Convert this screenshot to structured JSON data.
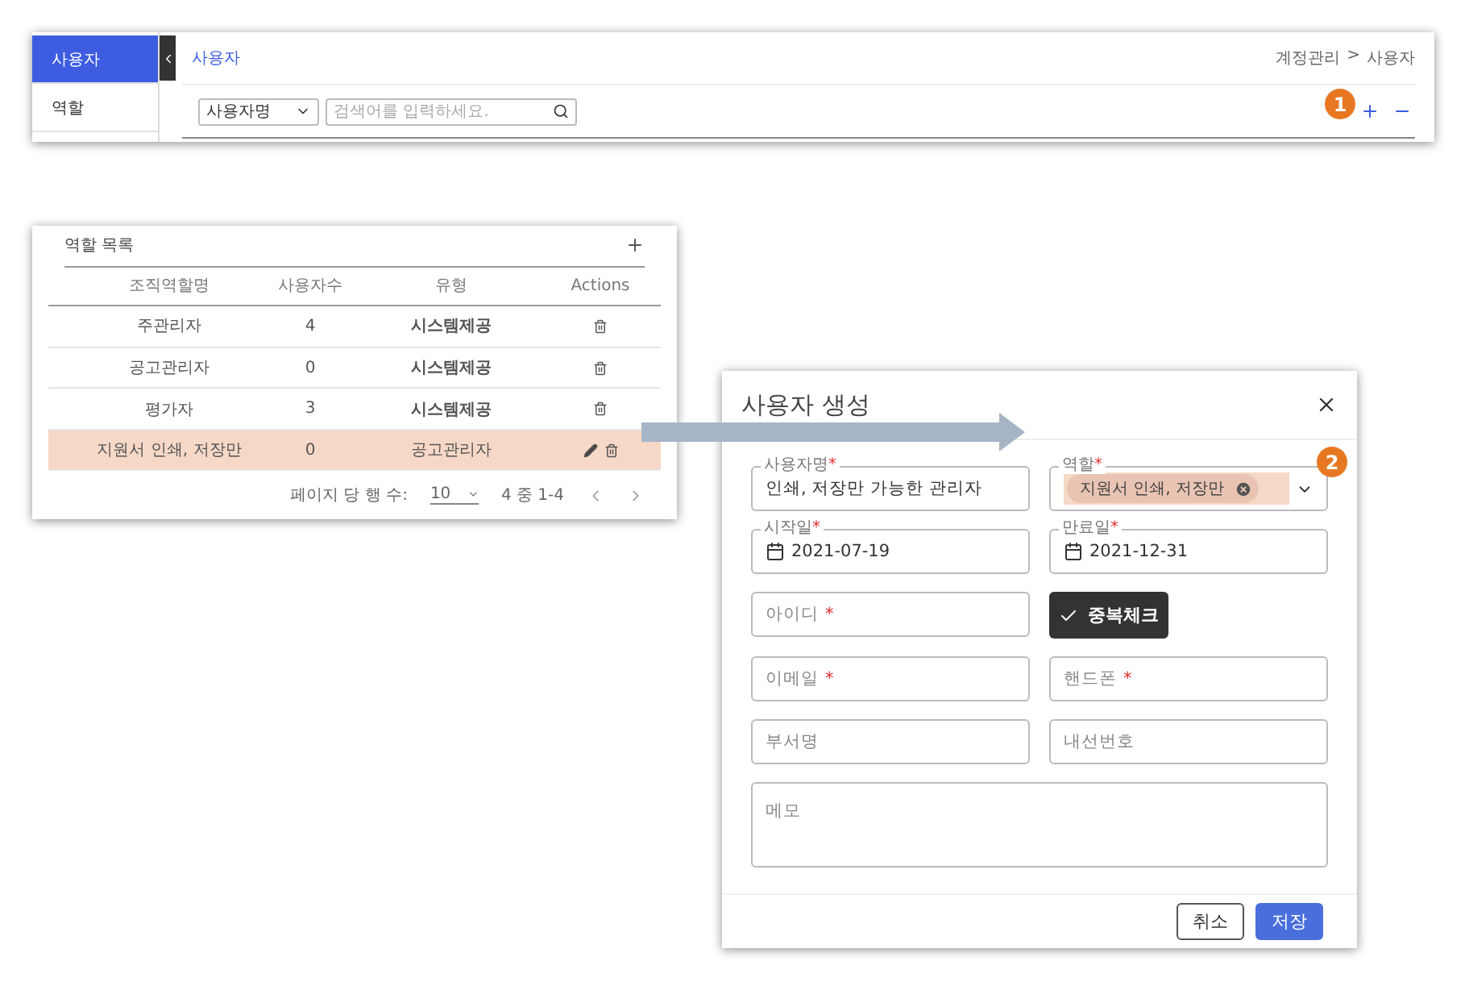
{
  "user_screen": {
    "sidebar": {
      "items": [
        {
          "label": "사용자",
          "selected": true
        },
        {
          "label": "역할",
          "selected": false
        }
      ]
    },
    "title": "사용자",
    "breadcrumb": [
      "계정관리",
      ">",
      "사용자"
    ],
    "search": {
      "select": "사용자명",
      "placeholder": "검색어를 입력하세요."
    },
    "badge": "1"
  },
  "role_list": {
    "title": "역할 목록",
    "columns": [
      "조직역할명",
      "사용자수",
      "유형",
      "Actions"
    ],
    "rows": [
      {
        "name": "주관리자",
        "count": "4",
        "type": "시스템제공",
        "system": true,
        "editable": false,
        "highlighted": false
      },
      {
        "name": "공고관리자",
        "count": "0",
        "type": "시스템제공",
        "system": true,
        "editable": false,
        "highlighted": false
      },
      {
        "name": "평가자",
        "count": "3",
        "type": "시스템제공",
        "system": true,
        "editable": false,
        "highlighted": false
      },
      {
        "name": "지원서 인쇄, 저장만",
        "count": "0",
        "type": "공고관리자",
        "system": false,
        "editable": true,
        "highlighted": true
      }
    ],
    "pagination": {
      "label": "페이지 당 행 수:",
      "rows_per_page": "10",
      "range": "4 중 1-4"
    }
  },
  "dialog": {
    "title": "사용자 생성",
    "fields": [
      {
        "kind": "text",
        "label": "사용자명",
        "mark": "*",
        "value": "인쇄, 저장만 가능한 관리자"
      },
      {
        "kind": "chips",
        "label": "역할",
        "mark": "*",
        "chips": [
          "지원서 인쇄, 저장만"
        ],
        "badge": "2"
      },
      {
        "kind": "date",
        "label": "시작일",
        "mark": "*",
        "value": "2021-07-19"
      },
      {
        "kind": "date",
        "label": "만료일",
        "mark": "*",
        "value": "2021-12-31"
      },
      {
        "kind": "empty",
        "placeholder": "아이디",
        "mark": "*"
      },
      {
        "kind": "button",
        "label": "중복체크"
      },
      {
        "kind": "empty",
        "placeholder": "이메일",
        "mark": "*"
      },
      {
        "kind": "empty",
        "placeholder": "핸드폰",
        "mark": "*"
      },
      {
        "kind": "empty",
        "placeholder": "부서명"
      },
      {
        "kind": "empty",
        "placeholder": "내선번호"
      },
      {
        "kind": "memo",
        "placeholder": "메모"
      }
    ],
    "buttons": [
      {
        "label": "취소",
        "primary": false
      },
      {
        "label": "저장",
        "primary": true
      }
    ]
  }
}
